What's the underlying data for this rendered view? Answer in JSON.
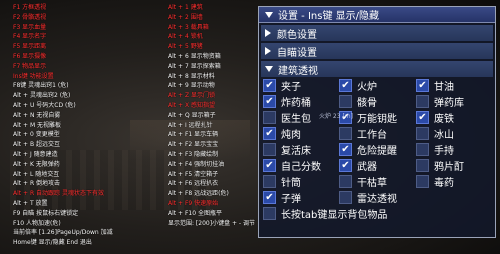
{
  "hud_left": [
    {
      "text": "F1 方框透视",
      "color": "red"
    },
    {
      "text": "F2 骨骼透视",
      "color": "red"
    },
    {
      "text": "F3 显示血量",
      "color": "red"
    },
    {
      "text": "F4 显示名字",
      "color": "red"
    },
    {
      "text": "F5 显示距离",
      "color": "red"
    },
    {
      "text": "F6 显示摄像",
      "color": "red"
    },
    {
      "text": "F7 物品显示",
      "color": "red"
    },
    {
      "text": "Ins键 功能设置",
      "color": "red"
    },
    {
      "text": "F8键 灵魂出窍1 (危)",
      "color": "white"
    },
    {
      "text": "Alt + 灵魂出窍2 (危)",
      "color": "white"
    },
    {
      "text": "Alt + U 号码大CD (危)",
      "color": "white"
    },
    {
      "text": "Alt + N 无视自雾",
      "color": "white"
    },
    {
      "text": "Alt + M 无视雕板",
      "color": "white"
    },
    {
      "text": "Alt + 0 变更模型",
      "color": "white"
    },
    {
      "text": "Alt + B 超远交互",
      "color": "white"
    },
    {
      "text": "Alt + J 随意建造",
      "color": "white"
    },
    {
      "text": "Alt + K 无限弹药",
      "color": "white"
    },
    {
      "text": "Alt + L 随地交互",
      "color": "white"
    },
    {
      "text": "Alt + R 倒地攻击",
      "color": "white"
    },
    {
      "text": "Alt + R 自动跟踪 灵魂状态下有效",
      "color": "red"
    },
    {
      "text": "Alt + T 放置",
      "color": "white"
    },
    {
      "text": "F9 自瞄 按鼠标右键锁定",
      "color": "white"
    },
    {
      "text": "F10 人物加速(危)",
      "color": "white"
    },
    {
      "text": "当前倍率 [1.26]PageUp/Down 加减",
      "color": "white"
    },
    {
      "text": "Home键 显示/隐藏 End 退出",
      "color": "white"
    }
  ],
  "hud_mid": [
    {
      "text": "Alt + 1 建筑",
      "color": "red"
    },
    {
      "text": "Alt + 2 围墙",
      "color": "red"
    },
    {
      "text": "Alt + 3 载具箱",
      "color": "red"
    },
    {
      "text": "Alt + 4 锁机",
      "color": "red"
    },
    {
      "text": "Alt + 5 野猪",
      "color": "red"
    },
    {
      "text": "Alt + 6 显示物资箱",
      "color": "white"
    },
    {
      "text": "Alt + 7 显示探索箱",
      "color": "white"
    },
    {
      "text": "Alt + 8 显示材料",
      "color": "white"
    },
    {
      "text": "Alt + 9 显示动物",
      "color": "white"
    },
    {
      "text": "Alt + Z 显示门锁",
      "color": "red"
    },
    {
      "text": "Alt + X 感知指望",
      "color": "red"
    },
    {
      "text": "Alt + Q 显示箱子",
      "color": "white"
    },
    {
      "text": "Alt + I 远程扎针",
      "color": "white"
    },
    {
      "text": "Alt + F1 显示车辆",
      "color": "white"
    },
    {
      "text": "Alt + F2 显示宝宝",
      "color": "white"
    },
    {
      "text": "Alt + F3 隐藏绘制",
      "color": "white"
    },
    {
      "text": "Alt + F4 强制切挂油",
      "color": "white"
    },
    {
      "text": "Alt + F5 清空箱子",
      "color": "white"
    },
    {
      "text": "Alt + F6 远程扒衣",
      "color": "white"
    },
    {
      "text": "Alt + F8 远战远距(危)",
      "color": "white"
    },
    {
      "text": "Alt + F9 快速原始",
      "color": "red"
    },
    {
      "text": "Alt + F10 全图瓶平",
      "color": "white"
    },
    {
      "text": "显示范围: [200]小键盘 + - 调节",
      "color": "white"
    }
  ],
  "menu": {
    "title": "设置 - Ins键 显示/隐藏",
    "sections": [
      {
        "label": "颜色设置",
        "expanded": false
      },
      {
        "label": "自瞄设置",
        "expanded": false
      },
      {
        "label": "建筑透视",
        "expanded": true
      }
    ],
    "grid": [
      {
        "label": "夹子",
        "checked": true
      },
      {
        "label": "火炉",
        "checked": true
      },
      {
        "label": "甘油",
        "checked": true
      },
      {
        "label": "炸药桶",
        "checked": true
      },
      {
        "label": "骸骨",
        "checked": false
      },
      {
        "label": "弹药库",
        "checked": false
      },
      {
        "label": "医生包",
        "checked": false
      },
      {
        "label": "万能钥匙",
        "checked": true
      },
      {
        "label": "废铁",
        "checked": true
      },
      {
        "label": "炖肉",
        "checked": true
      },
      {
        "label": "工作台",
        "checked": false
      },
      {
        "label": "冰山",
        "checked": false
      },
      {
        "label": "复活床",
        "checked": false
      },
      {
        "label": "危险提醒",
        "checked": true
      },
      {
        "label": "手持",
        "checked": false
      },
      {
        "label": "自己分数",
        "checked": true
      },
      {
        "label": "武器",
        "checked": true
      },
      {
        "label": "鸦片酊",
        "checked": false
      },
      {
        "label": "针筒",
        "checked": false
      },
      {
        "label": "干枯草",
        "checked": false
      },
      {
        "label": "毒药",
        "checked": false
      },
      {
        "label": "子弹",
        "checked": true
      },
      {
        "label": "雷达透视",
        "checked": false
      }
    ],
    "long_press": {
      "label": "长按tab键显示背包物品",
      "checked": false
    },
    "overlay_text": "火炉 23 [m]"
  }
}
